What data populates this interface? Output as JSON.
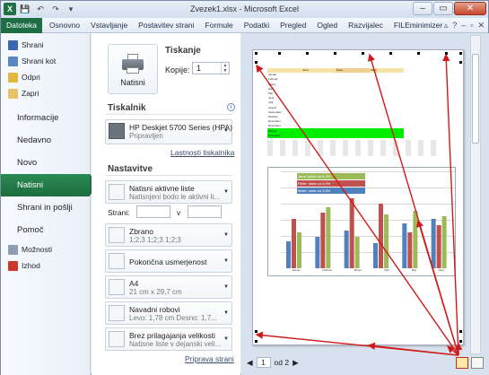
{
  "window": {
    "title": "Zvezek1.xlsx - Microsoft Excel"
  },
  "ribbon": {
    "tabs": [
      "Datoteka",
      "Osnovno",
      "Vstavljanje",
      "Postavitev strani",
      "Formule",
      "Podatki",
      "Pregled",
      "Ogled",
      "Razvijalec",
      "FILEminimizer"
    ]
  },
  "backstage": {
    "small_items": [
      "Shrani",
      "Shrani kot",
      "Odpri",
      "Zapri"
    ],
    "big_items": [
      "Informacije",
      "Nedavno",
      "Novo",
      "Natisni",
      "Shrani in pošlji",
      "Pomoč"
    ],
    "bottom_items": [
      "Možnosti",
      "Izhod"
    ],
    "selected": "Natisni"
  },
  "print": {
    "print_button_label": "Natisni",
    "heading": "Tiskanje",
    "copies_label": "Kopije:",
    "copies_value": "1",
    "printer_heading": "Tiskalnik",
    "printer_name": "HP Deskjet 5700 Series (HPA)",
    "printer_status": "Pripravljen",
    "printer_props_link": "Lastnosti tiskalnika",
    "settings_heading": "Nastavitve",
    "settings": [
      {
        "line1": "Natisni aktivne liste",
        "line2": "Natisnjeni bodo le aktivni li..."
      },
      {
        "line1": "Zbrano",
        "line2": "1;2;3    1;2;3    1;2;3"
      },
      {
        "line1": "Pokončna usmerjenost",
        "line2": ""
      },
      {
        "line1": "A4",
        "line2": "21 cm x 29,7 cm"
      },
      {
        "line1": "Navadni robovi",
        "line2": "Levo: 1,78 cm    Desno: 1,7..."
      },
      {
        "line1": "Brez prilagajanja velikosti",
        "line2": "Natisne liste v dejanski veli..."
      }
    ],
    "pages_label": "Strani:",
    "pages_to_label": "v",
    "page_setup_link": "Priprava strani"
  },
  "preview": {
    "current_page": "1",
    "of_pages": "od 2",
    "table_header": [
      "",
      "Jana",
      "Peter",
      "Matic"
    ],
    "months": [
      "Januar",
      "Februar",
      "Marec",
      "April",
      "Maj",
      "Junij",
      "Julij",
      "Avgust",
      "September",
      "Oktober",
      "November",
      "December",
      "Skupaj",
      "Povprečje"
    ],
    "legend": [
      "Jana: plača na 5,3%",
      "Peter: raste za 9,9%",
      "Matic: raste za 3,5%"
    ],
    "chart_categories": [
      "Januar",
      "Februar",
      "Marec",
      "April",
      "Maj",
      "Junij"
    ]
  },
  "colors": {
    "file_tab": "#1f6e43",
    "selected_item": "#1c6e3e",
    "series1": "#4f81bd",
    "series2": "#c0504d",
    "series3": "#9bbb59",
    "highlight_green": "#00ee00",
    "annotation_arrow": "#d01a1a"
  },
  "icons": {
    "save": "save-icon",
    "save_as": "save-as-icon",
    "open": "open-folder-icon",
    "close": "close-file-icon",
    "options": "options-icon",
    "exit": "exit-icon",
    "printer": "printer-icon"
  }
}
